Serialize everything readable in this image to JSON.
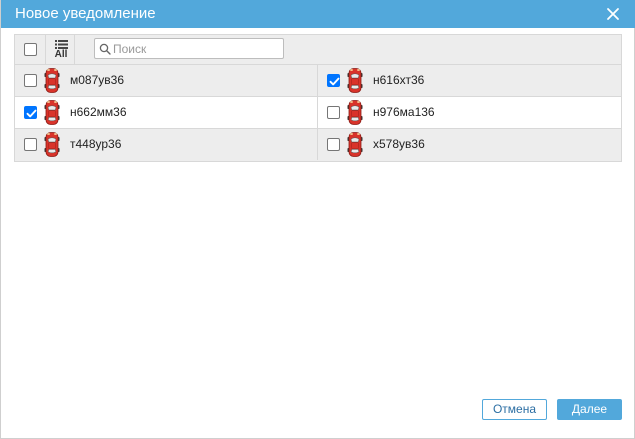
{
  "dialog": {
    "title": "Новое уведомление",
    "close_icon": "close-icon"
  },
  "toolbar": {
    "select_all_checked": false,
    "all_label": "All",
    "search_placeholder": "Поиск",
    "search_value": ""
  },
  "vehicles": [
    {
      "plate": "м087ув36",
      "checked": false
    },
    {
      "plate": "н616хт36",
      "checked": true
    },
    {
      "plate": "н662мм36",
      "checked": true
    },
    {
      "plate": "н976ма136",
      "checked": false
    },
    {
      "plate": "т448ур36",
      "checked": false
    },
    {
      "plate": "х578ув36",
      "checked": false
    }
  ],
  "buttons": {
    "cancel": "Отмена",
    "next": "Далее"
  },
  "colors": {
    "accent": "#52a8db",
    "checkbox_checked": "#0075ff",
    "car_red": "#d9332a"
  }
}
